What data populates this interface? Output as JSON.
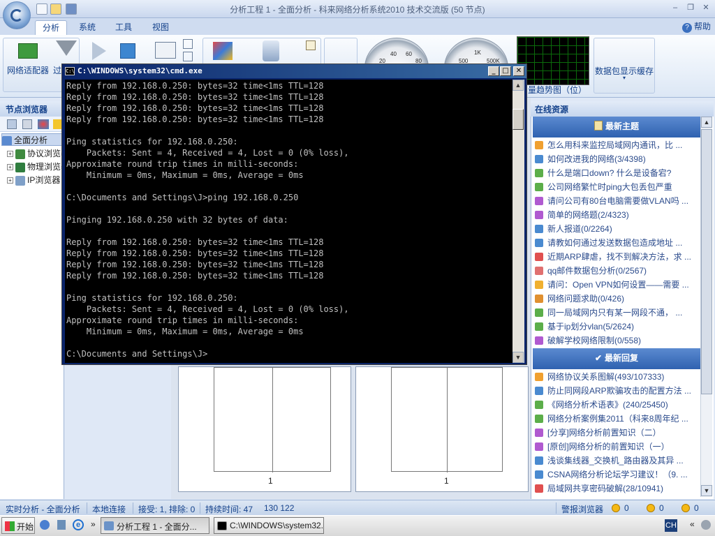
{
  "window": {
    "title": "分析工程 1 - 全面分析 - 科来网络分析系统2010 技术交流版 (50 节点)"
  },
  "ribbon": {
    "tabs": [
      "分析",
      "系统",
      "工具",
      "视图"
    ],
    "active_tab": "分析",
    "help_label": "帮助",
    "buttons": {
      "adapter": "网络适配器",
      "filter": "过",
      "trend_label": "量趋势图（位）",
      "packet_cache": "数据包显示缓存"
    },
    "gauge_ticks": {
      "left": [
        "40",
        "60",
        "20",
        "80"
      ],
      "right": [
        "1K",
        "500",
        "500K"
      ]
    }
  },
  "left_panel": {
    "title": "节点浏览器",
    "tree": [
      {
        "label": "全面分析",
        "selected": true
      },
      {
        "label": "协议浏览器"
      },
      {
        "label": "物理浏览器"
      },
      {
        "label": "IP浏览器"
      }
    ]
  },
  "right_panel": {
    "title": "在线资源",
    "section_latest_topics": "最新主题",
    "latest_topics": [
      "怎么用科来监控局域网内通讯，比 ...",
      "如何改进我的网络(3/4398)",
      "什么是端口down? 什么是设备宕?",
      "公司网络繁忙时ping大包丢包严重",
      "请问公司有80台电脑需要做VLAN吗 ...",
      "简单的网络题(2/4323)",
      "新人报道(0/2264)",
      "请教如何通过发送数据包造成地址 ...",
      "近期ARP肆虐，找不到解决方法，求 ...",
      "qq邮件数据包分析(0/2567)",
      "请问：Open VPN如何设置——需要 ...",
      "网络问题求助(0/426)",
      "同一局域网内只有某一网段不通， ...",
      "基于ip划分vlan(5/2624)",
      "破解学校网络限制(0/558)"
    ],
    "section_latest_replies": "最新回复",
    "latest_replies": [
      "网络协议关系图解(493/107333)",
      "防止同网段ARP欺骗攻击的配置方法 ...",
      "《网络分析术语表》(240/25450)",
      "网络分析案例集2011（科来8周年纪 ...",
      "[分享]网络分析前置知识（二）",
      "[原创]网络分析的前置知识（一）",
      "浅谈集线器_交换机_路由器及其异 ...",
      "CSNA网络分析论坛学习建议！（9. ...",
      "局域网共享密码破解(28/10941)"
    ]
  },
  "center": {
    "page_numbers": [
      "1",
      "1"
    ]
  },
  "cmd": {
    "title": "C:\\WINDOWS\\system32\\cmd.exe",
    "lines": [
      "Reply from 192.168.0.250: bytes=32 time<1ms TTL=128",
      "Reply from 192.168.0.250: bytes=32 time<1ms TTL=128",
      "Reply from 192.168.0.250: bytes=32 time<1ms TTL=128",
      "Reply from 192.168.0.250: bytes=32 time<1ms TTL=128",
      "",
      "Ping statistics for 192.168.0.250:",
      "    Packets: Sent = 4, Received = 4, Lost = 0 (0% loss),",
      "Approximate round trip times in milli-seconds:",
      "    Minimum = 0ms, Maximum = 0ms, Average = 0ms",
      "",
      "C:\\Documents and Settings\\J>ping 192.168.0.250",
      "",
      "Pinging 192.168.0.250 with 32 bytes of data:",
      "",
      "Reply from 192.168.0.250: bytes=32 time<1ms TTL=128",
      "Reply from 192.168.0.250: bytes=32 time<1ms TTL=128",
      "Reply from 192.168.0.250: bytes=32 time<1ms TTL=128",
      "Reply from 192.168.0.250: bytes=32 time<1ms TTL=128",
      "",
      "Ping statistics for 192.168.0.250:",
      "    Packets: Sent = 4, Received = 4, Lost = 0 (0% loss),",
      "Approximate round trip times in milli-seconds:",
      "    Minimum = 0ms, Maximum = 0ms, Average = 0ms",
      "",
      "C:\\Documents and Settings\\J>"
    ]
  },
  "status_bar": {
    "mode": "实时分析 - 全面分析",
    "connection": "本地连接",
    "received": "接受: 1, 排除: 0",
    "duration": "持续时间: 47",
    "coords": "130  122",
    "alarm_browser": "警报浏览器",
    "alarm_counts": [
      "0",
      "0",
      "0"
    ]
  },
  "taskbar": {
    "start": "开始",
    "tasks": [
      "分析工程 1 - 全面分...",
      "C:\\WINDOWS\\system32..."
    ],
    "ime": "CH",
    "overflow": "»",
    "tray_overflow": "«"
  }
}
